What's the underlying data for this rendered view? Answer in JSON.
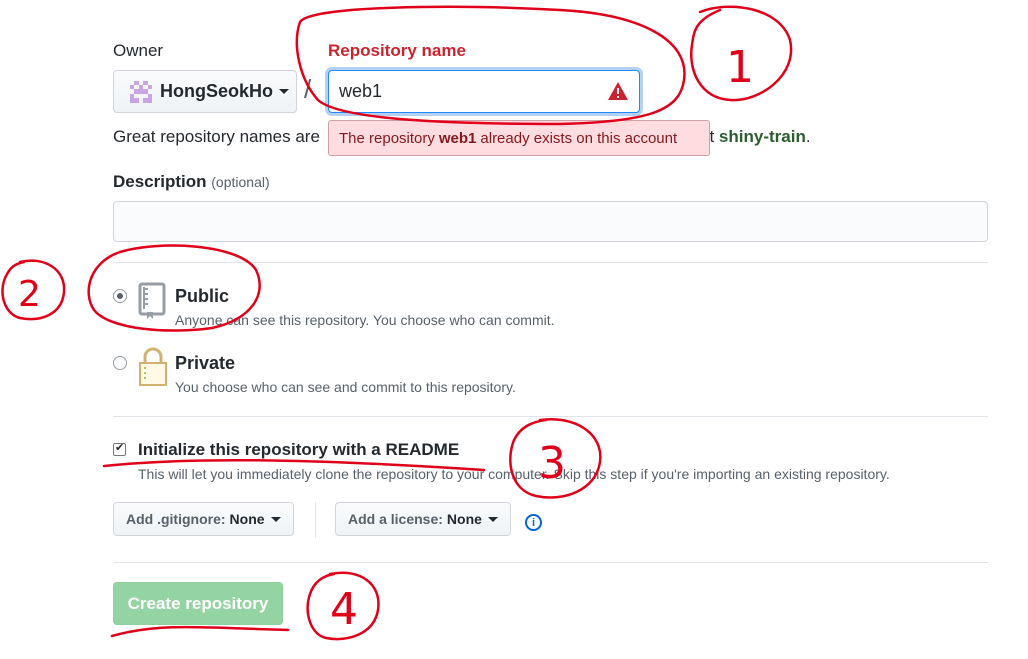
{
  "owner": {
    "label": "Owner",
    "name": "HongSeokHo"
  },
  "repo_name": {
    "label": "Repository name",
    "value": "web1",
    "separator": "/"
  },
  "error": {
    "prefix": "The repository",
    "name": "web1",
    "suffix": "already exists on this account"
  },
  "help": {
    "start": "Great repository names are",
    "end_prefix": "ut",
    "suggestion": "shiny-train",
    "end_suffix": "."
  },
  "description": {
    "label": "Description",
    "optional": "(optional)",
    "value": ""
  },
  "visibility": {
    "public": {
      "title": "Public",
      "desc": "Anyone can see this repository. You choose who can commit.",
      "checked": true
    },
    "private": {
      "title": "Private",
      "desc": "You choose who can see and commit to this repository.",
      "checked": false
    }
  },
  "init": {
    "title": "Initialize this repository with a README",
    "desc": "This will let you immediately clone the repository to your computer. Skip this step if you're importing an existing repository.",
    "checked": true
  },
  "gitignore": {
    "prefix": "Add .gitignore:",
    "value": "None"
  },
  "license": {
    "prefix": "Add a license:",
    "value": "None"
  },
  "info_icon": "i",
  "submit": {
    "label": "Create repository"
  },
  "annotations": [
    "1",
    "2",
    "3",
    "4"
  ],
  "colors": {
    "error_text": "#cb2431",
    "accent_blue": "#0366d6",
    "create_disabled": "#94d3a2",
    "annotation_red": "#e0001a"
  }
}
